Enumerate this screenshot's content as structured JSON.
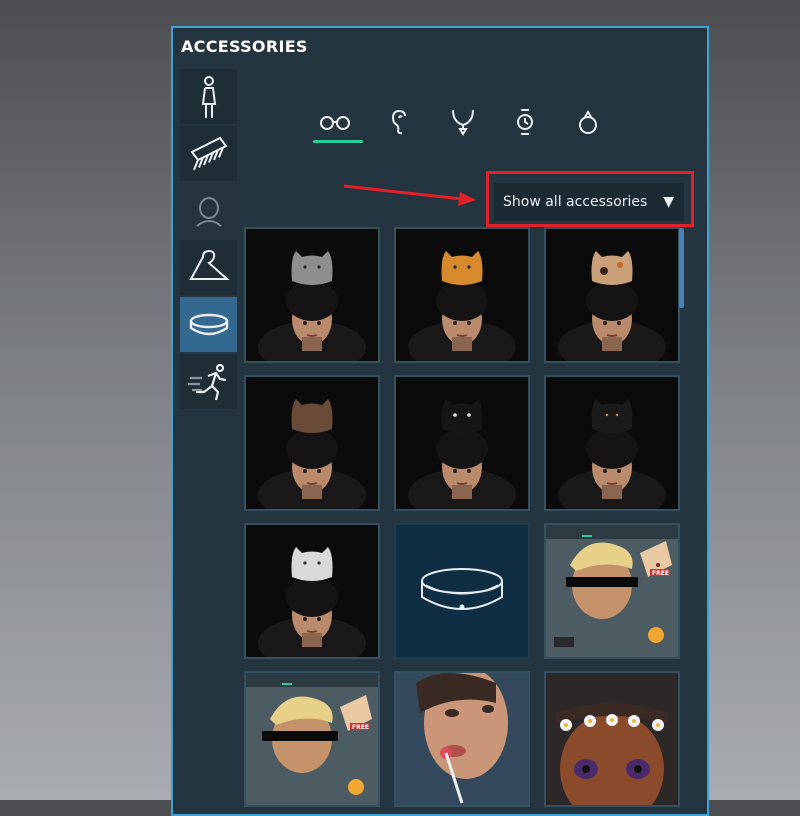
{
  "window": {
    "title": "ACCESSORIES"
  },
  "sidebar": {
    "items": [
      {
        "icon": "body-figure-icon",
        "state": "normal"
      },
      {
        "icon": "comb-icon",
        "state": "normal"
      },
      {
        "icon": "head-outline-icon",
        "state": "disabled"
      },
      {
        "icon": "hanger-icon",
        "state": "normal"
      },
      {
        "icon": "bracelet-icon",
        "state": "selected"
      },
      {
        "icon": "running-figure-icon",
        "state": "normal"
      }
    ]
  },
  "tabs": [
    {
      "icon": "glasses-icon",
      "selected": true
    },
    {
      "icon": "ear-icon",
      "selected": false
    },
    {
      "icon": "necklace-icon",
      "selected": false
    },
    {
      "icon": "watch-icon",
      "selected": false
    },
    {
      "icon": "ring-icon",
      "selected": false
    }
  ],
  "filter": {
    "label": "Show all accessories",
    "caret": "▼"
  },
  "tiles": [
    {
      "type": "avatar-hat",
      "hat_color": "#8e8e8e"
    },
    {
      "type": "avatar-hat",
      "hat_color": "#d68a2d"
    },
    {
      "type": "avatar-hat",
      "hat_color": "#caa07b"
    },
    {
      "type": "avatar-hat",
      "hat_color": "#6a4a38"
    },
    {
      "type": "avatar-hat",
      "hat_color": "#161616"
    },
    {
      "type": "avatar-hat",
      "hat_color": "#1b1b1b"
    },
    {
      "type": "avatar-hat",
      "hat_color": "#d9d9d9"
    },
    {
      "type": "bracelet-thumb",
      "selected": true
    },
    {
      "type": "preview-screenshot",
      "badge": "FREE"
    },
    {
      "type": "preview-screenshot",
      "badge": "FREE"
    },
    {
      "type": "face-lollipop"
    },
    {
      "type": "face-flower-crown"
    }
  ],
  "colors": {
    "panel_border": "#3fa2d6",
    "tab_active": "#2ecc9b",
    "highlight": "#e0202a",
    "selected_tile": "#0f2d43"
  }
}
